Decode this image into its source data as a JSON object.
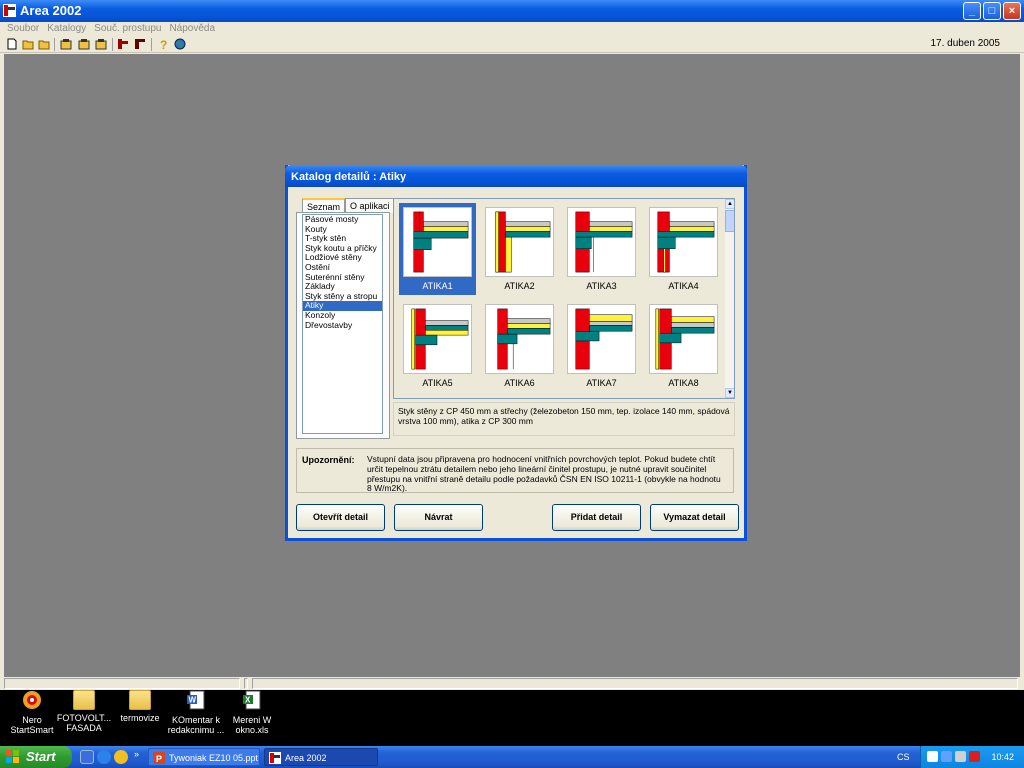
{
  "app": {
    "title": "Area 2002",
    "menu": [
      "Soubor",
      "Katalogy",
      "Souč. prostupu",
      "Nápověda"
    ],
    "date": "17. duben 2005"
  },
  "dialog": {
    "title": "Katalog detailů : Atiky",
    "tabs": [
      "Seznam",
      "O aplikaci"
    ],
    "categories": [
      "Pásové mosty",
      "Kouty",
      "T-styk stěn",
      "Styk koutu a příčky",
      "Lodžiové stěny",
      "Ostění",
      "Suterénní stěny",
      "Základy",
      "Styk stěny a stropu",
      "Atiky",
      "Konzoly",
      "Dřevostavby"
    ],
    "selected_category": "Atiky",
    "details": [
      "ATIKA1",
      "ATIKA2",
      "ATIKA3",
      "ATIKA4",
      "ATIKA5",
      "ATIKA6",
      "ATIKA7",
      "ATIKA8"
    ],
    "selected_detail": "ATIKA1",
    "description": "Styk stěny z CP 450 mm a střechy (železobeton 150 mm, tep. izolace 140 mm, spádová vrstva 100 mm), atika z CP 300 mm",
    "warning_label": "Upozornění:",
    "warning_text": "Vstupní data jsou připravena pro hodnocení vnitřních povrchových teplot. Pokud budete chtít určit tepelnou ztrátu detailem nebo jeho lineární činitel prostupu, je nutné upravit součinitel přestupu na vnitřní straně detailu podle požadavků ČSN EN ISO 10211-1 (obvykle na hodnotu 8 W/m2K).",
    "buttons": {
      "open": "Otevřít detail",
      "back": "Návrat",
      "add": "Přidat detail",
      "delete": "Vymazat detail"
    }
  },
  "desktop_icons": [
    {
      "label": "Nero StartSmart",
      "icon": "nero-icon"
    },
    {
      "label": "FOTOVOLT... FASADA",
      "icon": "folder-icon"
    },
    {
      "label": "termovize",
      "icon": "folder-icon"
    },
    {
      "label": "KOmentar k redakcnimu ...",
      "icon": "word-doc-icon"
    },
    {
      "label": "Mereni W okno.xls",
      "icon": "excel-doc-icon"
    }
  ],
  "taskbar": {
    "start_label": "Start",
    "tasks": [
      {
        "label": "Tywoniak EZ10 05.ppt",
        "active": false
      },
      {
        "label": "Area 2002",
        "active": true
      }
    ],
    "language": "CS",
    "clock": "10:42"
  }
}
